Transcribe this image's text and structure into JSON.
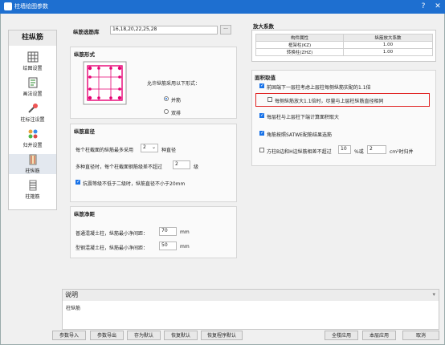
{
  "window": {
    "title": "柱墙绘图参数"
  },
  "sidebar": {
    "header": "柱纵筋",
    "items": [
      {
        "label": "绘图设置",
        "icon": "grid-icon"
      },
      {
        "label": "画法设置",
        "icon": "document-icon"
      },
      {
        "label": "柱标注设置",
        "icon": "tools-icon"
      },
      {
        "label": "归并设置",
        "icon": "dots-icon"
      },
      {
        "label": "柱纵筋",
        "icon": "column-rebar-icon"
      },
      {
        "label": "柱箍筋",
        "icon": "stirrup-icon"
      }
    ]
  },
  "rebar_library": {
    "label": "纵筋选筋库",
    "value": "16,18,20,22,25,28",
    "browse": "···"
  },
  "rebar_form": {
    "title": "纵筋形式",
    "prompt": "允许纵筋采用以下形式：",
    "option1": "并筋",
    "option2": "双排"
  },
  "rebar_diameter": {
    "title": "纵筋直径",
    "row1_pre": "每个柱截面的纵筋最多采用",
    "row1_value": "2",
    "row1_post": "种直径",
    "row2_label": "多种直径时，每个柱截面钢筋级差不超过",
    "row2_value": "2",
    "row2_post": "级",
    "row3_label": "抗震等级不低于二级时，纵筋直径不小于20mm"
  },
  "rebar_spacing": {
    "title": "纵筋净距",
    "row1_label": "普通混凝土柱，纵筋最小净间距：",
    "row1_value": "70",
    "row1_unit": "mm",
    "row2_label": "型钢混凝土柱，纵筋最小净间距：",
    "row2_value": "50",
    "row2_unit": "mm"
  },
  "amplification": {
    "title": "放大系数",
    "headers": [
      "构件属性",
      "纵筋放大系数"
    ],
    "rows": [
      [
        "框架柱(KZ)",
        "1.00"
      ],
      [
        "转换柱(ZHZ)",
        "1.00"
      ]
    ]
  },
  "area_selection": {
    "title": "面积取值",
    "opt1": "前固端下一层柱考虑上层柱每侧纵筋实配的1.1倍",
    "opt2": "每侧纵筋放大1.1倍时，尽量与上层柱纵筋直径相同",
    "opt3": "每层柱与上层柱下端计算面积取大",
    "opt4": "角筋按照SATWE配筋结果选筋",
    "opt5_pre": "方柱B边和H边纵筋相差不超过",
    "opt5_value1": "10",
    "opt5_mid": "%或",
    "opt5_value2": "2",
    "opt5_post": "cm²时归并",
    "highlight_color": "#e02020"
  },
  "description": {
    "title": "说明",
    "text": "柱纵筋"
  },
  "footer": {
    "import": "参数导入",
    "export": "参数导出",
    "save_default": "存为默认",
    "restore_default": "恢复默认",
    "restore_program": "恢复程序默认",
    "apply_all": "全楼应用",
    "apply_layer": "本层应用",
    "cancel": "取消"
  }
}
